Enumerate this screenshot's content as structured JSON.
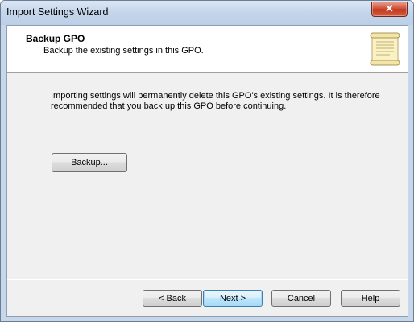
{
  "window": {
    "title": "Import Settings Wizard",
    "close_glyph": "✕"
  },
  "header": {
    "title": "Backup GPO",
    "subtitle": "Backup the existing settings in this GPO.",
    "icon": "scroll-icon"
  },
  "body": {
    "message": "Importing settings will permanently delete this GPO's existing settings.  It is therefore recommended that you back up this GPO before continuing.",
    "backup_button": "Backup..."
  },
  "footer": {
    "back": "< Back",
    "next": "Next >",
    "cancel": "Cancel",
    "help": "Help"
  },
  "colors": {
    "frame": "#c7d7ea",
    "client": "#f0f0f0",
    "close": "#c23a22",
    "default_button_border": "#3c7fb1"
  }
}
